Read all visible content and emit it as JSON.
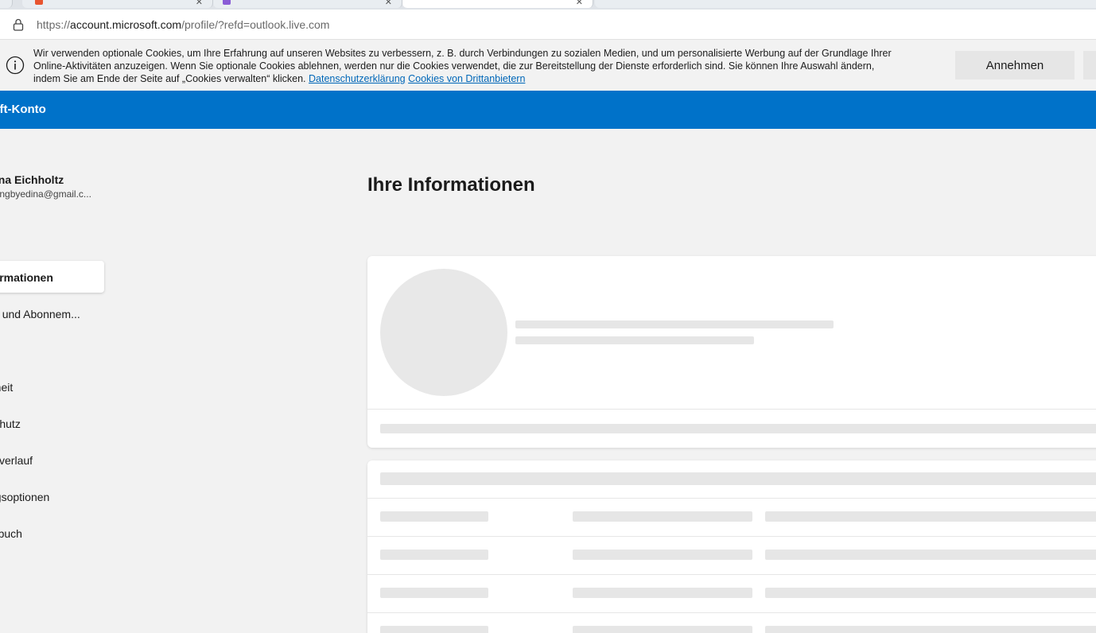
{
  "browser": {
    "url_scheme": "https://",
    "url_host": "account.microsoft.com",
    "url_path": "/profile/?refd=outlook.live.com",
    "tab_close_glyph": "✕"
  },
  "cookie_banner": {
    "text": "Wir verwenden optionale Cookies, um Ihre Erfahrung auf unseren Websites zu verbessern, z. B. durch Verbindungen zu sozialen Medien, und um personalisierte Werbung auf der Grundlage Ihrer Online-Aktivitäten anzuzeigen. Wenn Sie optionale Cookies ablehnen, werden nur die Cookies verwendet, die zur Bereitstellung der Dienste erforderlich sind. Sie können Ihre Auswahl ändern, indem Sie am Ende der Seite auf „Cookies verwalten“ klicken.",
    "privacy_link": "Datenschutzerklärung",
    "third_party_link": "Cookies von Drittanbietern",
    "accept_label": "Annehmen"
  },
  "header": {
    "title": "Microsoft-Konto",
    "background": "#0072c9"
  },
  "sidebar": {
    "user_name": "Edina Eichholtz",
    "user_email": "traininingbyedina@gmail.c...",
    "items": [
      {
        "label": "Ihre Informationen",
        "active": true
      },
      {
        "label": "Geräte und Abonnem..."
      },
      {
        "label": "Sicherheit"
      },
      {
        "label": "Datenschutz"
      },
      {
        "label": "Bestellverlauf"
      },
      {
        "label": "Zahlungsoptionen"
      },
      {
        "label": "Adressbuch"
      }
    ]
  },
  "main": {
    "page_title": "Ihre Informationen"
  },
  "icons": {
    "address_lock": "lock-icon",
    "cookie_info": "info-icon"
  },
  "colors": {
    "link": "#0067b8",
    "page_bg": "#f2f2f2",
    "skeleton": "#e6e6e6"
  }
}
